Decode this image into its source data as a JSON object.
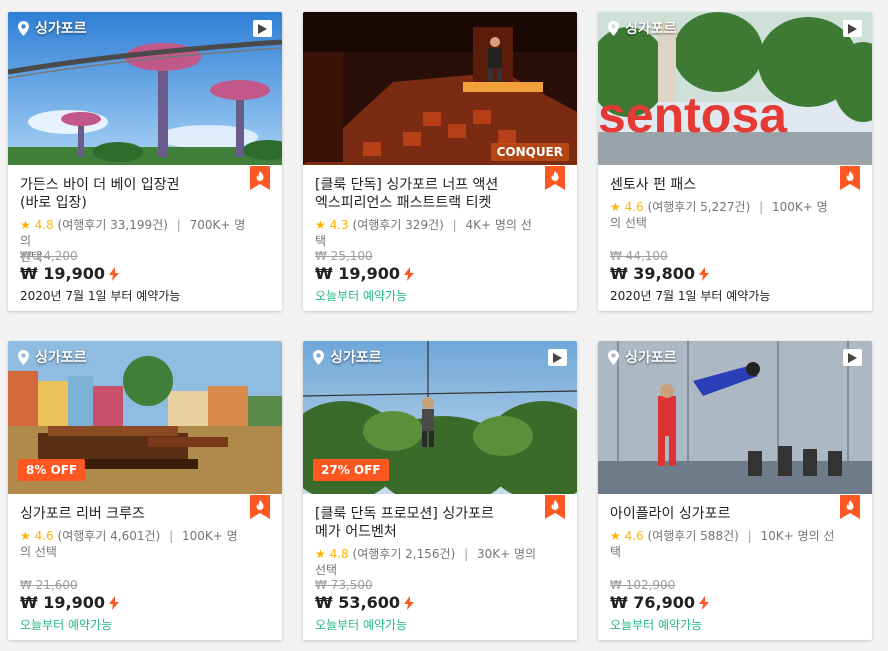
{
  "colors": {
    "accent": "#ff5722",
    "star": "#ffb400",
    "available": "#24b985"
  },
  "cards": [
    {
      "location": "싱가포르",
      "has_video": true,
      "discount": "",
      "title_line1": "가든스 바이 더 베이 입장권",
      "title_line2": "(바로 입장)",
      "rating": "4.8",
      "reviews": "(여행후기 33,199건)",
      "booked": "700K+ 명의",
      "booked2": "선택",
      "old_price": "₩ 24,200",
      "price": "₩ 19,900",
      "availability": "2020년 7월 1일 부터 예약가능",
      "avail_style": "dark"
    },
    {
      "location": "",
      "has_video": false,
      "discount": "",
      "title_line1": "[클룩 단독] 싱가포르 너프 액션",
      "title_line2": "엑스피리언스 패스트트랙 티켓",
      "rating": "4.3",
      "reviews": "(여행후기 329건)",
      "booked": "4K+ 명의 선택",
      "booked2": "",
      "old_price": "₩ 25,100",
      "price": "₩ 19,900",
      "availability": "오늘부터 예약가능",
      "avail_style": "green",
      "overlay_text": "CONQUER"
    },
    {
      "location": "싱가포르",
      "has_video": true,
      "discount": "",
      "title_line1": "센토사 펀 패스",
      "title_line2": "",
      "rating": "4.6",
      "reviews": "(여행후기 5,227건)",
      "booked": "100K+ 명의 선택",
      "booked2": "",
      "old_price": "₩ 44,100",
      "price": "₩ 39,800",
      "availability": "2020년 7월 1일 부터 예약가능",
      "avail_style": "dark",
      "overlay_text": "sentosa"
    },
    {
      "location": "싱가포르",
      "has_video": false,
      "discount": "8% OFF",
      "title_line1": "싱가포르 리버 크루즈",
      "title_line2": "",
      "rating": "4.6",
      "reviews": "(여행후기 4,601건)",
      "booked": "100K+ 명의 선택",
      "booked2": "",
      "old_price": "₩ 21,600",
      "price": "₩ 19,900",
      "availability": "오늘부터 예약가능",
      "avail_style": "green"
    },
    {
      "location": "싱가포르",
      "has_video": true,
      "discount": "27% OFF",
      "title_line1": "[클룩 단독 프로모션] 싱가포르",
      "title_line2": "메가 어드벤처",
      "rating": "4.8",
      "reviews": "(여행후기 2,156건)",
      "booked": "30K+ 명의 선택",
      "booked2": "",
      "old_price": "₩ 73,500",
      "price": "₩ 53,600",
      "availability": "오늘부터 예약가능",
      "avail_style": "green"
    },
    {
      "location": "싱가포르",
      "has_video": true,
      "discount": "",
      "title_line1": "아이플라이 싱가포르",
      "title_line2": "",
      "rating": "4.6",
      "reviews": "(여행후기 588건)",
      "booked": "10K+ 명의 선택",
      "booked2": "",
      "old_price": "₩ 102,900",
      "price": "₩ 76,900",
      "availability": "오늘부터 예약가능",
      "avail_style": "green"
    }
  ]
}
